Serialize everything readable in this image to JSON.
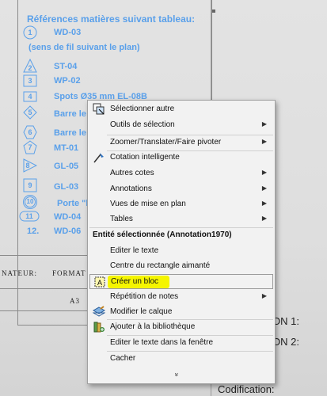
{
  "drawing": {
    "title": "Références matières suivant tableau:",
    "note": "(sens de fil suivant le plan)",
    "refs": [
      {
        "num": "1",
        "code": "WD-03"
      },
      {
        "num": "2",
        "code": "ST-04"
      },
      {
        "num": "3",
        "code": "WP-02"
      },
      {
        "num": "4",
        "code": "Spots Ø35 mm EL-08B"
      },
      {
        "num": "5",
        "code": "Barre le"
      },
      {
        "num": "6",
        "code": "Barre le"
      },
      {
        "num": "7",
        "code": "MT-01"
      },
      {
        "num": "8",
        "code": "GL-05"
      },
      {
        "num": "9",
        "code": "GL-03"
      },
      {
        "num": "10",
        "code": "Porte \"li"
      },
      {
        "num": "11",
        "code": "WD-04"
      },
      {
        "num": "12.",
        "code": "WD-06"
      }
    ],
    "titleblock": {
      "designer_label": "NATEUR:",
      "format_label": "FORMAT",
      "format_value": "A3"
    },
    "right_labels": [
      "ON 1:",
      "ON 2:",
      "Codification:"
    ]
  },
  "menu": {
    "items": [
      {
        "label": "Sélectionner autre",
        "icon": "select-other-icon"
      },
      {
        "label": "Outils de sélection",
        "submenu": true
      },
      {
        "label": "Zoomer/Translater/Faire pivoter",
        "submenu": true
      },
      {
        "label": "Cotation intelligente",
        "icon": "smart-dimension-icon"
      },
      {
        "label": "Autres cotes",
        "submenu": true
      },
      {
        "label": "Annotations",
        "submenu": true
      },
      {
        "label": "Vues de mise en plan",
        "submenu": true
      },
      {
        "label": "Tables",
        "submenu": true
      },
      {
        "label": "Entité sélectionnée (Annotation1970)",
        "header": true
      },
      {
        "label": "Editer le texte"
      },
      {
        "label": "Centre du rectangle aimanté"
      },
      {
        "label": "Créer un bloc",
        "icon": "create-block-icon",
        "highlighted": true
      },
      {
        "label": "Répétition de notes",
        "submenu": true
      },
      {
        "label": "Modifier le calque",
        "icon": "layer-icon"
      },
      {
        "label": "Ajouter à la bibliothèque",
        "icon": "library-icon"
      },
      {
        "label": "Editer le texte dans la fenêtre"
      },
      {
        "label": "Cacher"
      }
    ],
    "more_glyph": "»",
    "submenu_glyph": "▶",
    "highlight_color": "#f5f500"
  }
}
